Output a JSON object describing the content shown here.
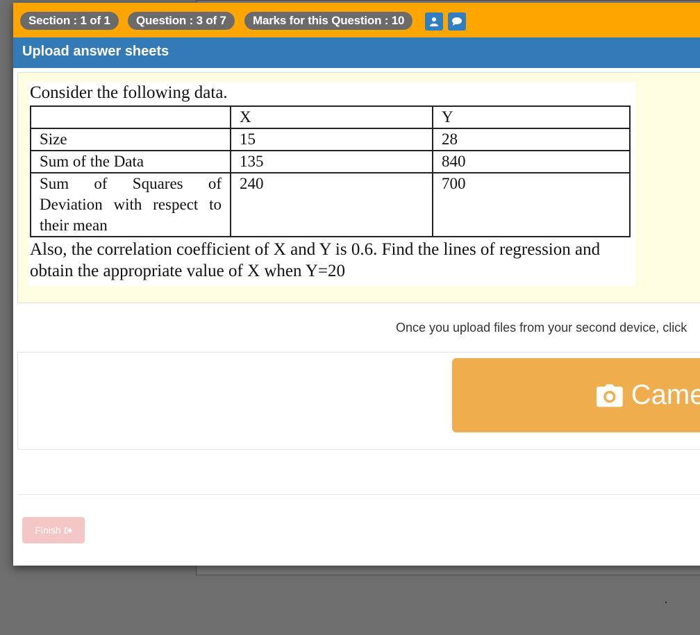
{
  "topbar": {
    "section": "Section : 1 of 1",
    "question": "Question : 3 of 7",
    "marks": "Marks for this Question : 10",
    "user_icon": "user-icon",
    "chat_icon": "chat-icon"
  },
  "header": {
    "title": "Upload answer sheets"
  },
  "question": {
    "intro": "Consider the following data.",
    "table": {
      "headers": [
        "",
        "X",
        "Y"
      ],
      "rows": [
        [
          "Size",
          "15",
          "28"
        ],
        [
          "Sum of the Data",
          "135",
          "840"
        ],
        [
          "Sum of Squares of Deviation with respect to their mean",
          "240",
          "700"
        ]
      ]
    },
    "outro": "Also, the correlation coefficient of X and Y is 0.6. Find the lines of regression and obtain the appropriate value of X when Y=20"
  },
  "upload": {
    "info_text": "Once you upload files from your second device, click",
    "camera_label": "Camera",
    "camera_icon": "camera-icon"
  },
  "footer": {
    "finish_label": "Finish",
    "finish_icon": "sign-out-icon"
  },
  "colors": {
    "topbar": "#ffa500",
    "pill": "#6b6b6b",
    "header": "#337ab7",
    "question_bg": "#fffde1",
    "camera": "#f0ad4e",
    "finish": "#f4c6c6"
  }
}
